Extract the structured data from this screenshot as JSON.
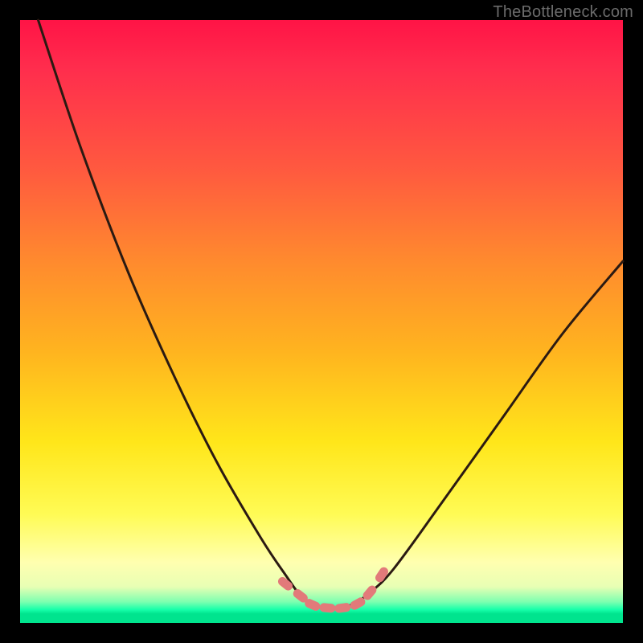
{
  "watermark": "TheBottleneck.com",
  "colors": {
    "page_bg": "#000000",
    "curve_stroke": "#2b1a12",
    "marker_fill": "#e27a7a",
    "gradient_top": "#ff1446",
    "gradient_bottom": "#00e48e"
  },
  "chart_data": {
    "type": "line",
    "title": "",
    "xlabel": "",
    "ylabel": "",
    "xlim": [
      0,
      100
    ],
    "ylim": [
      0,
      100
    ],
    "grid": false,
    "legend": false,
    "note": "V-shaped bottleneck curve over a red→green vertical gradient. Axis values are estimated from pixel positions (no tick labels in source image).",
    "series": [
      {
        "name": "bottleneck-curve",
        "x": [
          3,
          10,
          18,
          26,
          33,
          40,
          44,
          47,
          50,
          52,
          55,
          58,
          62,
          70,
          80,
          90,
          100
        ],
        "y": [
          100,
          79,
          58,
          40,
          26,
          14,
          8,
          4,
          2.5,
          2.5,
          3,
          5,
          9,
          20,
          34,
          48,
          60
        ]
      }
    ],
    "markers": {
      "name": "flat-minimum-dots",
      "note": "Salmon-pink capsule/dot markers along the flat bottom of the V.",
      "x": [
        44,
        46.5,
        48.5,
        51,
        53.5,
        56,
        58,
        60
      ],
      "y": [
        6.5,
        4.5,
        3,
        2.5,
        2.5,
        3.2,
        5,
        8
      ]
    }
  }
}
